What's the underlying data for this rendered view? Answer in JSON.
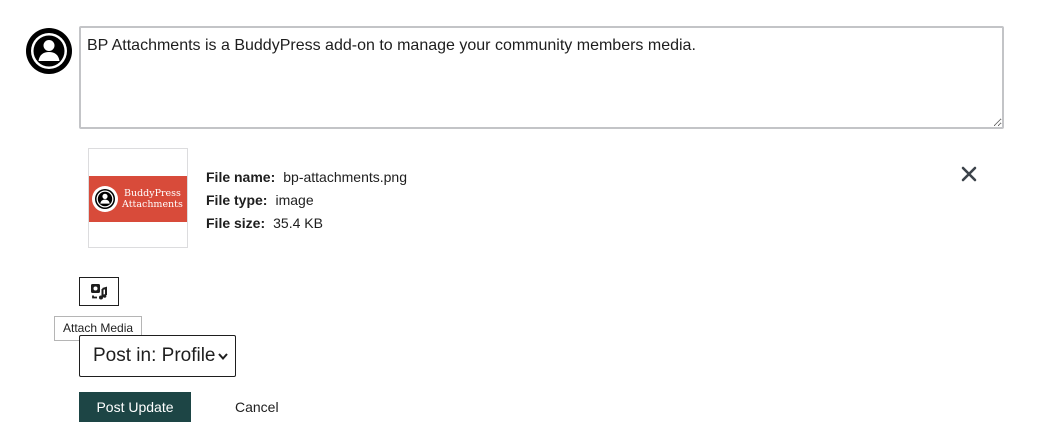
{
  "composer": {
    "text": "BP Attachments is a BuddyPress add-on to manage your community members media."
  },
  "attachment": {
    "thumbnail_brand_line1": "BuddyPress",
    "thumbnail_brand_line2": "Attachments",
    "thumbnail_color": "#d84b3a",
    "file_name_label": "File name:",
    "file_name": "bp-attachments.png",
    "file_type_label": "File type:",
    "file_type": "image",
    "file_size_label": "File size:",
    "file_size": "35.4 KB",
    "remove_icon": "close-icon"
  },
  "toolbar": {
    "attach_icon": "media-icon",
    "tooltip": "Attach Media"
  },
  "post_in": {
    "selected": "Post in: Profile"
  },
  "actions": {
    "post_label": "Post Update",
    "cancel_label": "Cancel",
    "post_color": "#1d4545"
  }
}
